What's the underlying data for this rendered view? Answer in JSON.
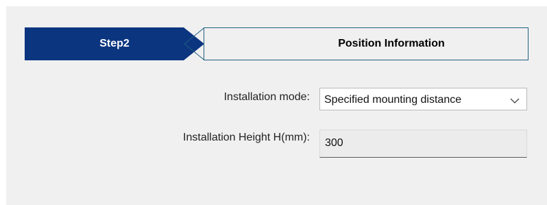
{
  "stepper": {
    "step_label": "Step2",
    "title": "Position Information",
    "colors": {
      "active_bg": "#0c3580",
      "inactive_border": "#1f5f80"
    }
  },
  "form": {
    "installation_mode": {
      "label": "Installation mode:",
      "value": "Specified mounting distance",
      "icon": "chevron-down-icon"
    },
    "installation_height": {
      "label": "Installation Height H(mm):",
      "value": "300"
    }
  }
}
